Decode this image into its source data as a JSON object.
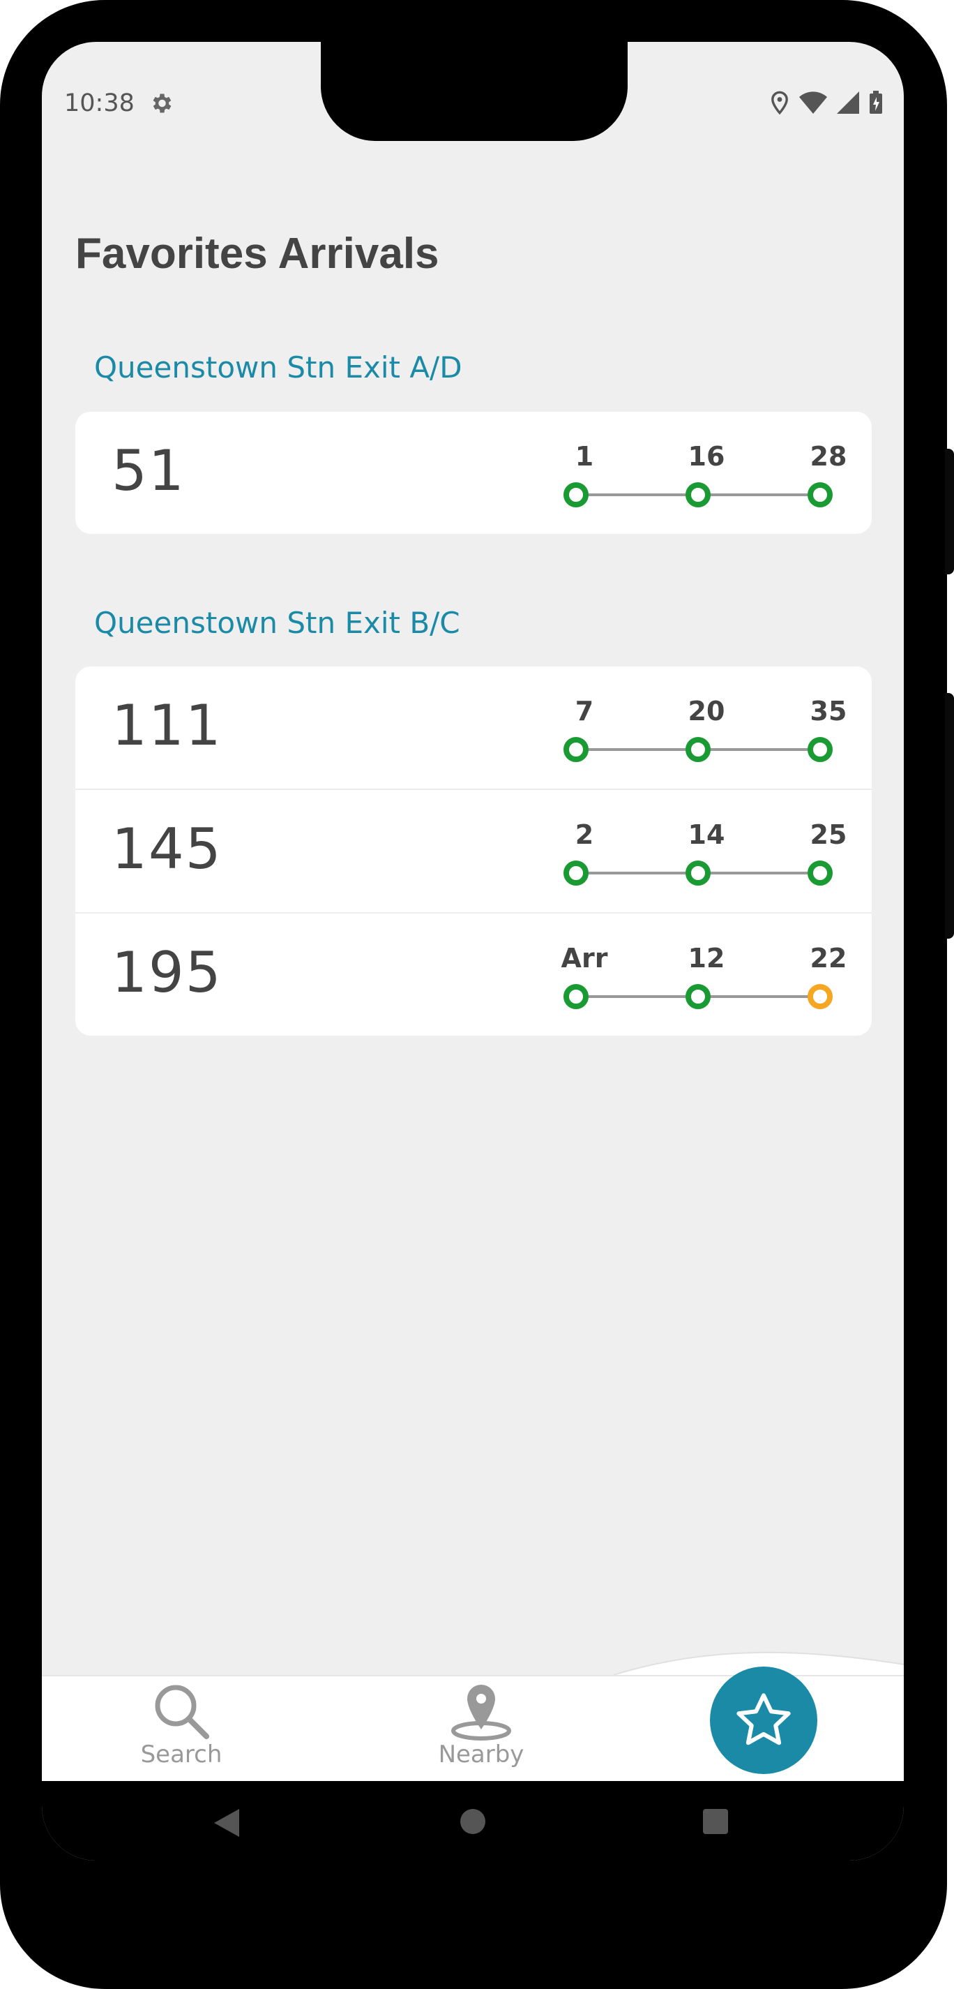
{
  "status_bar": {
    "time": "10:38",
    "icons": [
      "gear-icon",
      "location-icon",
      "wifi-icon",
      "signal-icon",
      "battery-icon"
    ]
  },
  "page": {
    "title": "Favorites Arrivals"
  },
  "stops": [
    {
      "name": "Queenstown Stn Exit A/D",
      "services": [
        {
          "number": "51",
          "arrivals": [
            {
              "label": "1",
              "status": "green"
            },
            {
              "label": "16",
              "status": "green"
            },
            {
              "label": "28",
              "status": "green"
            }
          ]
        }
      ]
    },
    {
      "name": "Queenstown Stn Exit B/C",
      "services": [
        {
          "number": "111",
          "arrivals": [
            {
              "label": "7",
              "status": "green"
            },
            {
              "label": "20",
              "status": "green"
            },
            {
              "label": "35",
              "status": "green"
            }
          ]
        },
        {
          "number": "145",
          "arrivals": [
            {
              "label": "2",
              "status": "green"
            },
            {
              "label": "14",
              "status": "green"
            },
            {
              "label": "25",
              "status": "green"
            }
          ]
        },
        {
          "number": "195",
          "arrivals": [
            {
              "label": "Arr",
              "status": "green"
            },
            {
              "label": "12",
              "status": "green"
            },
            {
              "label": "22",
              "status": "orange"
            }
          ]
        }
      ]
    }
  ],
  "bottom_nav": {
    "search_label": "Search",
    "nearby_label": "Nearby",
    "favorites_icon": "star-icon"
  },
  "colors": {
    "accent": "#1a8aa7",
    "green": "#1a9a33",
    "orange": "#f5a623"
  }
}
